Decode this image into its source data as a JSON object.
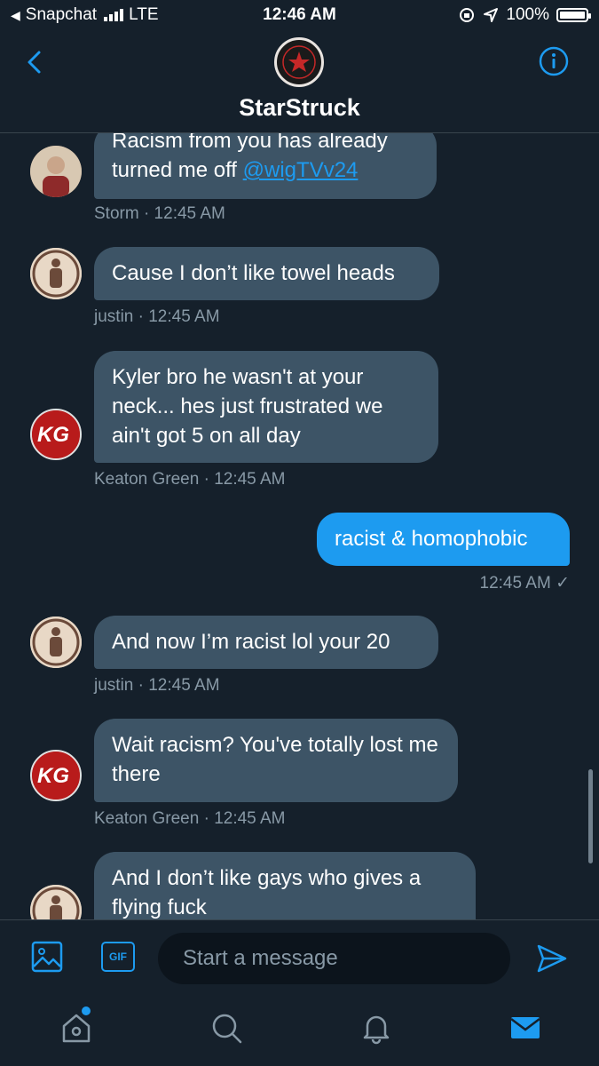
{
  "status_bar": {
    "back_app": "Snapchat",
    "network": "LTE",
    "time": "12:46 AM",
    "battery": "100%",
    "icons": [
      "back-triangle-icon",
      "signal-icon",
      "orientation-lock-icon",
      "location-arrow-icon",
      "battery-icon"
    ]
  },
  "header": {
    "title": "StarStruck",
    "icons": [
      "back-chevron-icon",
      "info-icon"
    ]
  },
  "messages": [
    {
      "sender": "Storm",
      "time": "12:45 AM",
      "direction": "in",
      "text": "Racism from you has already turned me off",
      "mention": "@wigTVv24",
      "meta": "Storm · 12:45 AM"
    },
    {
      "sender": "justin",
      "time": "12:45 AM",
      "direction": "in",
      "text": "Cause I don’t like towel heads",
      "meta": "justin · 12:45 AM"
    },
    {
      "sender": "Keaton Green",
      "time": "12:45 AM",
      "direction": "in",
      "text": "Kyler bro he wasn't at your neck... hes just frustrated we ain't got 5 on all day",
      "meta": "Keaton Green · 12:45 AM"
    },
    {
      "sender": "me",
      "time": "12:45 AM",
      "direction": "out",
      "text": "racist & homophobic",
      "meta": "12:45 AM ✓"
    },
    {
      "sender": "justin",
      "time": "12:45 AM",
      "direction": "in",
      "text": "And now I’m racist lol your 20",
      "meta": "justin · 12:45 AM"
    },
    {
      "sender": "Keaton Green",
      "time": "12:45 AM",
      "direction": "in",
      "text": "Wait racism? You've totally lost me there",
      "meta": "Keaton Green · 12:45 AM"
    },
    {
      "sender": "justin",
      "direction": "in",
      "text": "And I don’t like gays who gives a flying fuck"
    }
  ],
  "avatars": {
    "kg_initials": "KG"
  },
  "composer": {
    "placeholder": "Start a message",
    "gif_label": "GIF",
    "icons": [
      "image-icon",
      "gif-icon",
      "send-icon"
    ]
  },
  "tab_bar": {
    "icons": [
      "home-icon",
      "search-icon",
      "notifications-bell-icon",
      "messages-mail-icon"
    ],
    "active": "messages-mail-icon"
  },
  "colors": {
    "background": "#15202b",
    "bubble_in": "#3d5466",
    "bubble_out": "#1d9bf0",
    "accent": "#1d9bf0",
    "meta_text": "#8899a6"
  }
}
